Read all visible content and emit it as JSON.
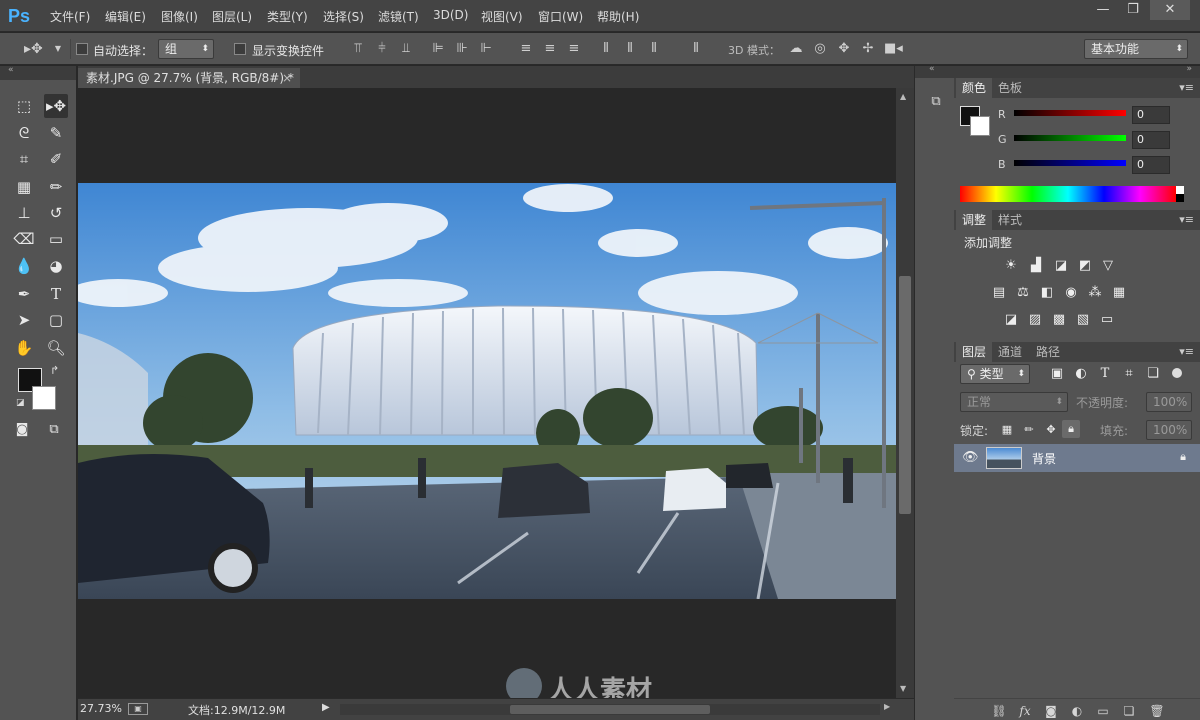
{
  "app": {
    "logo": "Ps"
  },
  "menu": [
    "文件(F)",
    "编辑(E)",
    "图像(I)",
    "图层(L)",
    "类型(Y)",
    "选择(S)",
    "滤镜(T)",
    "3D(D)",
    "视图(V)",
    "窗口(W)",
    "帮助(H)"
  ],
  "window_controls": {
    "minimize": "—",
    "restore": "❐",
    "close": "✕"
  },
  "options": {
    "auto_select_label": "自动选择：",
    "auto_select_value": "组",
    "transform_label": "显示变换控件",
    "mode3d_label": "3D 模式：",
    "workspace": "基本功能"
  },
  "document": {
    "tab_title": "素材.JPG @ 27.7% (背景, RGB/8#) *",
    "tab_close": "×"
  },
  "status": {
    "zoom": "27.73%",
    "doc_info": "文档:12.9M/12.9M"
  },
  "color_panel": {
    "tabs": [
      "颜色",
      "色板"
    ],
    "channels": [
      {
        "label": "R",
        "value": "0"
      },
      {
        "label": "G",
        "value": "0"
      },
      {
        "label": "B",
        "value": "0"
      }
    ]
  },
  "adjust_panel": {
    "tabs": [
      "调整",
      "样式"
    ],
    "title": "添加调整"
  },
  "layers_panel": {
    "tabs": [
      "图层",
      "通道",
      "路径"
    ],
    "filter_kind": "类型",
    "blend_mode": "正常",
    "opacity_label": "不透明度:",
    "opacity_value": "100%",
    "lock_label": "锁定:",
    "fill_label": "填充:",
    "fill_value": "100%",
    "layer_name": "背景"
  },
  "watermark": {
    "text": "人人素材"
  },
  "colors": {
    "accent": "#4ab3ff",
    "panel": "#535353",
    "dark": "#282828",
    "layer_selected": "#6e7a8e"
  }
}
